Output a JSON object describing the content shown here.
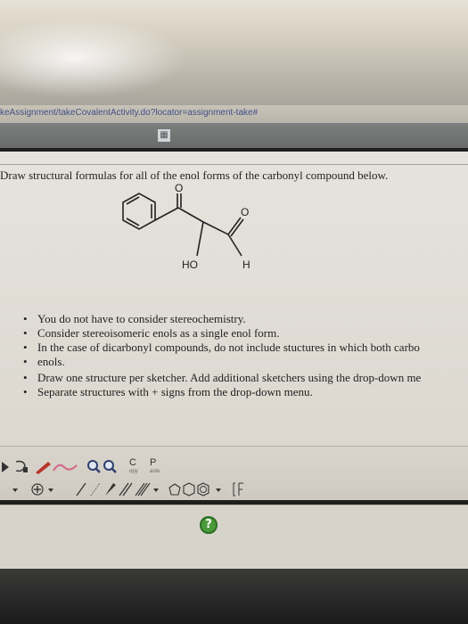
{
  "browser": {
    "url": "keAssignment/takeCovalentActivity.do?locator=assignment-take#"
  },
  "question": {
    "prompt": "Draw structural formulas for all of the enol forms of the carbonyl compound below."
  },
  "molecule": {
    "labels": {
      "ho": "HO",
      "h": "H",
      "o1": "O",
      "o2": "O"
    }
  },
  "instructions": [
    "You do not have to consider stereochemistry.",
    "Consider stereoisomeric enols as a single enol form.",
    "In the case of dicarbonyl compounds, do not include stuctures in which both carbo",
    "enols.",
    "Draw one structure per sketcher. Add additional sketchers using the drop-down me",
    "Separate structures with + signs from the drop-down menu."
  ],
  "toolbar": {
    "copy_label": "C",
    "copy_sub": "opy",
    "paste_label": "P",
    "paste_sub": "aste"
  },
  "colors": {
    "url": "#3f4f87",
    "help_button": "#4a9a3a",
    "undo_tool": "#b8342a",
    "eraser_tool": "#d26a8a"
  }
}
